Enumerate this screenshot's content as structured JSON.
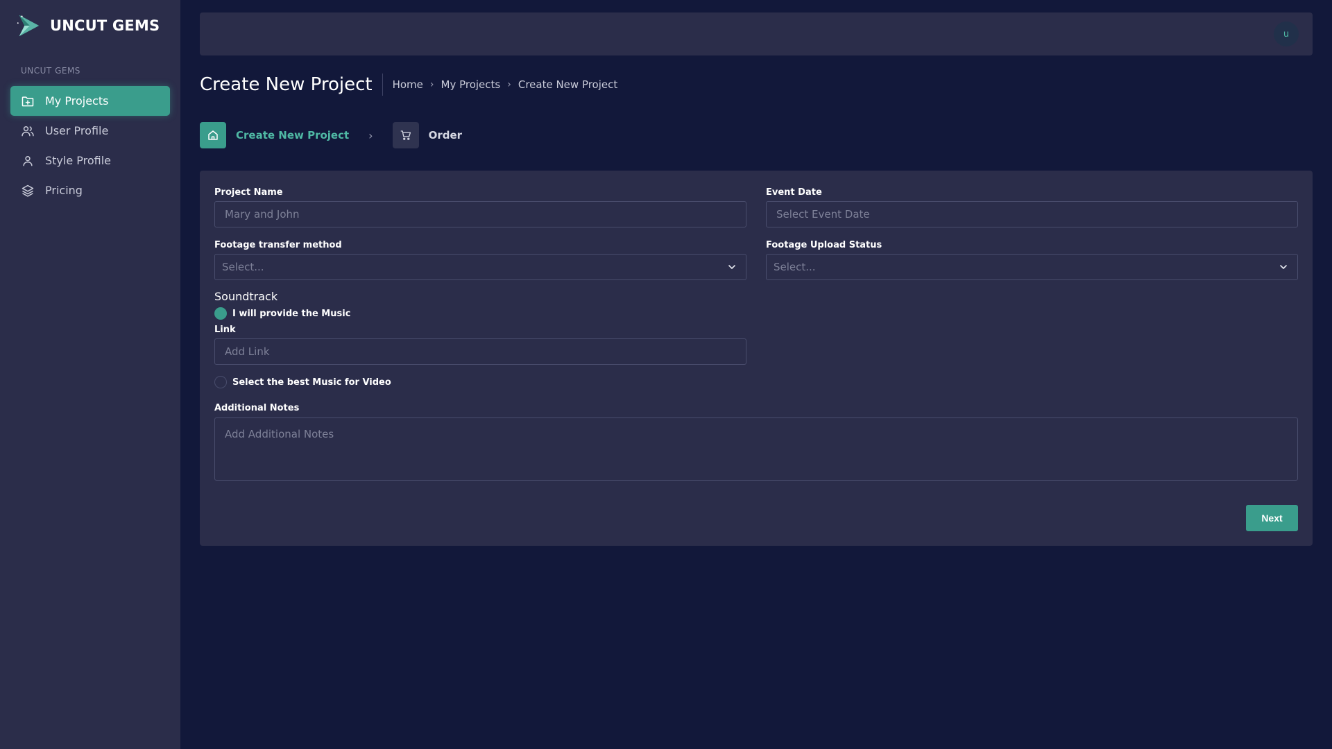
{
  "brand": {
    "name": "UNCUT GEMS"
  },
  "sidebar": {
    "section_label": "UNCUT GEMS",
    "items": [
      {
        "label": "My Projects",
        "icon": "folder-plus-icon",
        "active": true
      },
      {
        "label": "User Profile",
        "icon": "users-icon",
        "active": false
      },
      {
        "label": "Style Profile",
        "icon": "user-icon",
        "active": false
      },
      {
        "label": "Pricing",
        "icon": "layers-icon",
        "active": false
      }
    ]
  },
  "topbar": {
    "avatar_initial": "u"
  },
  "header": {
    "title": "Create New Project",
    "breadcrumb": [
      "Home",
      "My Projects",
      "Create New Project"
    ]
  },
  "stepper": {
    "steps": [
      {
        "label": "Create New Project",
        "icon": "home-icon",
        "active": true
      },
      {
        "label": "Order",
        "icon": "cart-icon",
        "active": false
      }
    ]
  },
  "form": {
    "project_name": {
      "label": "Project Name",
      "placeholder": "Mary and John"
    },
    "event_date": {
      "label": "Event Date",
      "placeholder": "Select Event Date"
    },
    "footage_transfer": {
      "label": "Footage transfer method",
      "value": "Select..."
    },
    "footage_upload": {
      "label": "Footage Upload Status",
      "value": "Select..."
    },
    "soundtrack": {
      "title": "Soundtrack",
      "option_provide": "I will provide the Music",
      "link_label": "Link",
      "link_placeholder": "Add Link",
      "option_select": "Select the best Music for Video"
    },
    "notes": {
      "label": "Additional Notes",
      "placeholder": "Add Additional Notes"
    },
    "next_label": "Next"
  },
  "colors": {
    "accent": "#3a9d8c",
    "background": "#12183a",
    "panel": "#2b2d4a"
  }
}
